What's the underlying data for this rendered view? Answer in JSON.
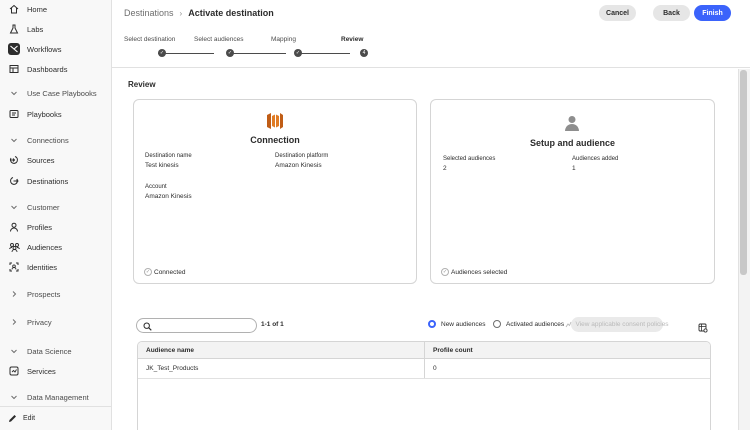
{
  "sidebar": {
    "items": [
      {
        "label": "Home",
        "icon": "home-icon"
      },
      {
        "label": "Labs",
        "icon": "labs-icon"
      },
      {
        "label": "Workflows",
        "icon": "workflows-icon"
      },
      {
        "label": "Dashboards",
        "icon": "dashboards-icon"
      },
      {
        "label": "Use Case Playbooks",
        "icon": "chevron-down-icon"
      },
      {
        "label": "Playbooks",
        "icon": "playbooks-icon"
      },
      {
        "label": "Connections",
        "icon": "chevron-down-icon"
      },
      {
        "label": "Sources",
        "icon": "sources-icon"
      },
      {
        "label": "Destinations",
        "icon": "destinations-icon"
      },
      {
        "label": "Customer",
        "icon": "chevron-down-icon"
      },
      {
        "label": "Profiles",
        "icon": "profiles-icon"
      },
      {
        "label": "Audiences",
        "icon": "audiences-icon"
      },
      {
        "label": "Identities",
        "icon": "identities-icon"
      },
      {
        "label": "Prospects",
        "icon": "chevron-right-icon"
      },
      {
        "label": "Privacy",
        "icon": "chevron-right-icon"
      },
      {
        "label": "Data Science",
        "icon": "chevron-down-icon"
      },
      {
        "label": "Services",
        "icon": "services-icon"
      },
      {
        "label": "Data Management",
        "icon": "chevron-down-icon"
      }
    ],
    "footer_label": "Edit"
  },
  "header": {
    "breadcrumb_parent": "Destinations",
    "breadcrumb_separator": "›",
    "breadcrumb_current": "Activate destination",
    "cancel_label": "Cancel",
    "back_label": "Back",
    "finish_label": "Finish"
  },
  "stepper": {
    "steps": [
      {
        "label": "Select destination",
        "state": "done",
        "marker": "✓"
      },
      {
        "label": "Select audiences",
        "state": "done",
        "marker": "✓"
      },
      {
        "label": "Mapping",
        "state": "done",
        "marker": "✓"
      },
      {
        "label": "Review",
        "state": "current",
        "marker": "4"
      }
    ]
  },
  "review": {
    "title": "Review",
    "connection": {
      "title": "Connection",
      "destination_name_label": "Destination name",
      "destination_name_value": "Test kinesis",
      "destination_platform_label": "Destination platform",
      "destination_platform_value": "Amazon Kinesis",
      "account_label": "Account",
      "account_value": "Amazon Kinesis",
      "status": "Connected"
    },
    "setup": {
      "title": "Setup and audience",
      "selected_audiences_label": "Selected audiences",
      "selected_audiences_value": "2",
      "audiences_added_label": "Audiences added",
      "audiences_added_value": "1",
      "status": "Audiences selected"
    }
  },
  "toolbar": {
    "search_placeholder": "",
    "count_text": "1-1 of 1",
    "radio_new": "New audiences",
    "radio_activated": "Activated audiences",
    "selected_radio": "New audiences",
    "policies_button": "View applicable consent policies"
  },
  "table": {
    "columns": [
      "Audience name",
      "Profile count"
    ],
    "rows": [
      [
        "JK_Test_Products",
        "0"
      ]
    ]
  },
  "colors": {
    "accent": "#3b63fb",
    "aws_orange": "#e07b24"
  }
}
